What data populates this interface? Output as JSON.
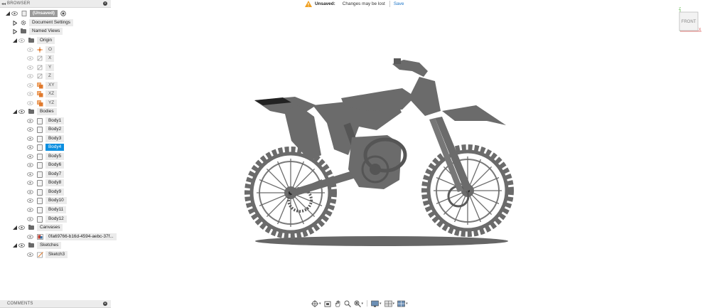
{
  "browser": {
    "title": "BROWSER",
    "root_label": "(Unsaved)",
    "items": [
      {
        "label": "Document Settings"
      },
      {
        "label": "Named Views"
      },
      {
        "label": "Origin"
      },
      {
        "label": "O"
      },
      {
        "label": "X"
      },
      {
        "label": "Y"
      },
      {
        "label": "Z"
      },
      {
        "label": "XY"
      },
      {
        "label": "XZ"
      },
      {
        "label": "YZ"
      },
      {
        "label": "Bodies"
      },
      {
        "label": "Body1"
      },
      {
        "label": "Body2"
      },
      {
        "label": "Body3"
      },
      {
        "label": "Body4"
      },
      {
        "label": "Body5"
      },
      {
        "label": "Body6"
      },
      {
        "label": "Body7"
      },
      {
        "label": "Body8"
      },
      {
        "label": "Body9"
      },
      {
        "label": "Body10"
      },
      {
        "label": "Body11"
      },
      {
        "label": "Body12"
      },
      {
        "label": "Canvases"
      },
      {
        "label": "0fa69766-b16d-4594-aebc-37f..."
      },
      {
        "label": "Sketches"
      },
      {
        "label": "Sketch3"
      }
    ]
  },
  "comments": {
    "title": "COMMENTS"
  },
  "notice": {
    "status": "Unsaved:",
    "message": "Changes may be lost",
    "save_label": "Save"
  },
  "viewcube": {
    "face": "FRONT",
    "axis_z": "Z",
    "axis_x": "X"
  },
  "colors": {
    "selected": "#0d8fe0",
    "model": "#6b6b6b",
    "origin_accent": "#e07a2e"
  }
}
